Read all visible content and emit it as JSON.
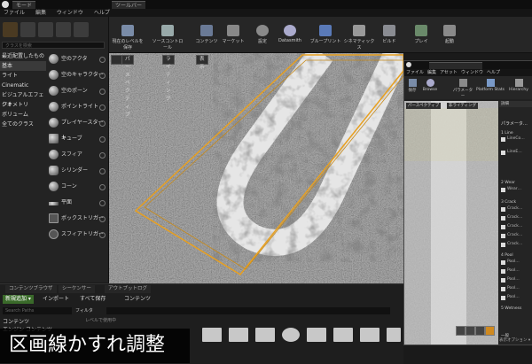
{
  "titlebar": {
    "tab1": "モード",
    "tab2": "ツールバー"
  },
  "menubar": {
    "items": [
      "ファイル",
      "編集",
      "ウィンドウ",
      "ヘルプ"
    ]
  },
  "modes": {
    "search_placeholder": "クラスを検索",
    "categories": [
      "最近配置したもの",
      "基本",
      "ライト",
      "Cinematic",
      "ビジュアルエフェクト",
      "ジオメトリ",
      "ボリューム",
      "全てのクラス"
    ],
    "selected_category": 1,
    "placeables": [
      "空のアクタ",
      "空のキャラクター",
      "空のポーン",
      "ポイントライト",
      "プレイヤースタート",
      "キューブ",
      "スフィア",
      "シリンダー",
      "コーン",
      "平面",
      "ボックストリガー",
      "スフィアトリガー"
    ]
  },
  "toolbar": {
    "buttons": [
      "現在のレベルを保存",
      "ソースコントロール",
      "コンテンツ",
      "マーケット",
      "設定",
      "Datasmith",
      "ブループリント",
      "シネマティックス",
      "ビルド",
      "プレイ",
      "起動"
    ]
  },
  "viewport": {
    "perspective": "パースペクティブ",
    "lighting": "ライティング",
    "show": "表示"
  },
  "float": {
    "menu": [
      "ファイル",
      "編集",
      "アセット",
      "ウィンドウ",
      "ヘルプ"
    ],
    "buttons": [
      "保存",
      "Browse",
      "パラメーター",
      "Platform Stats",
      "Hierarchy"
    ],
    "viewport_perspective": "パースペクティブ",
    "viewport_lighting": "非ライティング",
    "details_tab": "詳細",
    "params_header": "パラメータ…",
    "groups": [
      "1 Line",
      "2 Wear",
      "3 Crack",
      "4 Pool",
      "5 Wetness",
      "一般"
    ],
    "items": [
      "LineCo…",
      "LineE…",
      "Wear…",
      "Crack…",
      "Crack…",
      "Crack…",
      "Crack…",
      "Crack…",
      "Pool…",
      "Pool…",
      "Pool…",
      "Pool…",
      "Pool…"
    ],
    "footer": "表示オプション ▾"
  },
  "content_browser": {
    "tabs": [
      "コンテンツブラウザ",
      "シーケンサー",
      "アウトプットログ"
    ],
    "add_new": "新規追加 ▾",
    "import": "インポート",
    "save_all": "すべて保存",
    "path": "コンテンツ",
    "search_placeholder": "Search Paths",
    "filter": "フィルタ",
    "tree": [
      "コンテンツ",
      "エンジン コンテンツ"
    ],
    "unused_label": "レベルで使用中"
  },
  "caption": "区画線かすれ調整",
  "colors": {
    "selection": "#e8a020",
    "ui_dark": "#1e1e1e",
    "accent_blue": "#2a6fd6"
  }
}
